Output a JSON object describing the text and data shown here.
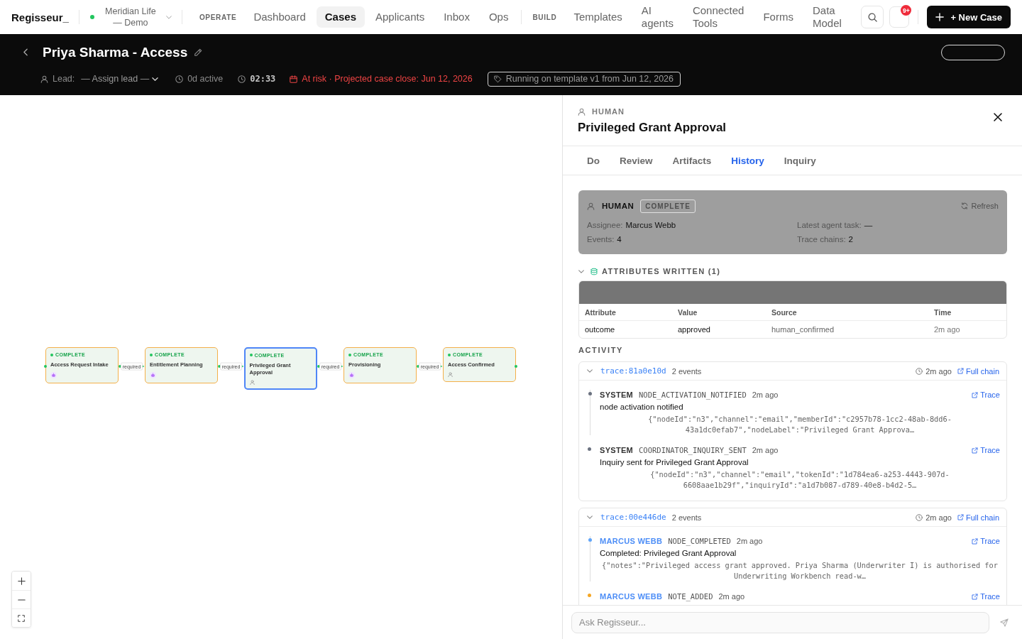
{
  "top_nav": {
    "logo": "Regisseur_",
    "workspace": "Meridian Life — Demo",
    "sections": [
      {
        "label": "OPERATE",
        "items": [
          {
            "label": "Dashboard",
            "selected": false
          },
          {
            "label": "Cases",
            "selected": true
          },
          {
            "label": "Applicants",
            "selected": false
          },
          {
            "label": "Inbox",
            "selected": false
          },
          {
            "label": "Ops",
            "selected": false
          }
        ]
      },
      {
        "label": "BUILD",
        "items": [
          {
            "label": "Templates",
            "selected": false
          },
          {
            "label": "AI agents",
            "selected": false
          },
          {
            "label": "Connected Tools",
            "selected": false
          },
          {
            "label": "Forms",
            "selected": false
          },
          {
            "label": "Data Model",
            "selected": false
          }
        ]
      }
    ],
    "notification_count": "9+",
    "new_case_button": "+ New Case"
  },
  "case_header": {
    "title": "Priya Sharma - Access",
    "lead_label": "Lead:",
    "lead_value": "— Assign lead —",
    "active_time": "0d active",
    "timer": "02:33",
    "risk": "At risk · Projected case close: Jun 12, 2026",
    "template_badge": "Running on template v1 from Jun 12, 2026"
  },
  "canvas": {
    "nodes": [
      {
        "status": "COMPLETE",
        "label": "Access Request Intake",
        "kind": "agent",
        "selected": false
      },
      {
        "status": "COMPLETE",
        "label": "Entitlement Planning",
        "kind": "agent",
        "selected": false
      },
      {
        "status": "COMPLETE",
        "label": "Privileged Grant Approval",
        "kind": "human",
        "selected": true
      },
      {
        "status": "COMPLETE",
        "label": "Provisioning",
        "kind": "agent",
        "selected": false
      },
      {
        "status": "COMPLETE",
        "label": "Access Confirmed",
        "kind": "human",
        "selected": false
      }
    ],
    "edges": [
      {
        "label": "required"
      },
      {
        "label": "required"
      },
      {
        "label": "required"
      },
      {
        "label": "required"
      }
    ]
  },
  "panel": {
    "kind_label": "HUMAN",
    "title": "Privileged Grant Approval",
    "tabs": [
      {
        "label": "Do",
        "selected": false
      },
      {
        "label": "Review",
        "selected": false
      },
      {
        "label": "Artifacts",
        "selected": false
      },
      {
        "label": "History",
        "selected": true
      },
      {
        "label": "Inquiry",
        "selected": false
      }
    ],
    "summary": {
      "kind_label": "HUMAN",
      "status": "COMPLETE",
      "refresh": "Refresh",
      "fields": [
        {
          "label": "Assignee:",
          "value": "Marcus Webb"
        },
        {
          "label": "Latest agent task:",
          "value": "—"
        },
        {
          "label": "Events:",
          "value": "4"
        },
        {
          "label": "Trace chains:",
          "value": "2"
        }
      ]
    },
    "attributes": {
      "title": "ATTRIBUTES WRITTEN (1)",
      "expanded": true,
      "columns": [
        "Attribute",
        "Value",
        "Source",
        "Time"
      ],
      "rows": [
        [
          "outcome",
          "approved",
          "human_confirmed",
          "2m ago"
        ]
      ]
    },
    "activity": {
      "title": "ACTIVITY",
      "traces": [
        {
          "id": "trace:81a0e10d",
          "count": "2 events",
          "time": "2m ago",
          "link": "Full chain",
          "expanded": true,
          "events": [
            {
              "actor": "SYSTEM",
              "kind": "system",
              "color": "#6b7280",
              "type": "NODE_ACTIVATION_NOTIFIED",
              "time": "2m ago",
              "link": "Trace",
              "summary": "node activation notified",
              "payload": "{\"nodeId\":\"n3\",\"channel\":\"email\",\"memberId\":\"c2957b78-1cc2-48ab-8dd6-43a1dc0efab7\",\"nodeLabel\":\"Privileged Grant Approva…"
            },
            {
              "actor": "SYSTEM",
              "kind": "system",
              "color": "#6b7280",
              "type": "COORDINATOR_INQUIRY_SENT",
              "time": "2m ago",
              "link": "Trace",
              "summary": "Inquiry sent for Privileged Grant Approval",
              "payload": "{\"nodeId\":\"n3\",\"channel\":\"email\",\"tokenId\":\"1d784ea6-a253-4443-907d-6608aae1b29f\",\"inquiryId\":\"a1d7b087-d789-40e8-b4d2-5…"
            }
          ]
        },
        {
          "id": "trace:00e446de",
          "count": "2 events",
          "time": "2m ago",
          "link": "Full chain",
          "expanded": true,
          "events": [
            {
              "actor": "MARCUS WEBB",
              "kind": "user",
              "color": "#60a5fa",
              "type": "NODE_COMPLETED",
              "time": "2m ago",
              "link": "Trace",
              "summary": "Completed: Privileged Grant Approval",
              "payload": "{\"notes\":\"Privileged access grant approved. Priya Sharma (Underwriter I) is authorised for Underwriting Workbench read-w…"
            },
            {
              "actor": "MARCUS WEBB",
              "kind": "user",
              "color": "#f5a623",
              "type": "NOTE_ADDED",
              "time": "2m ago",
              "link": "Trace"
            }
          ]
        }
      ]
    }
  },
  "chat": {
    "placeholder": "Ask Regisseur..."
  }
}
